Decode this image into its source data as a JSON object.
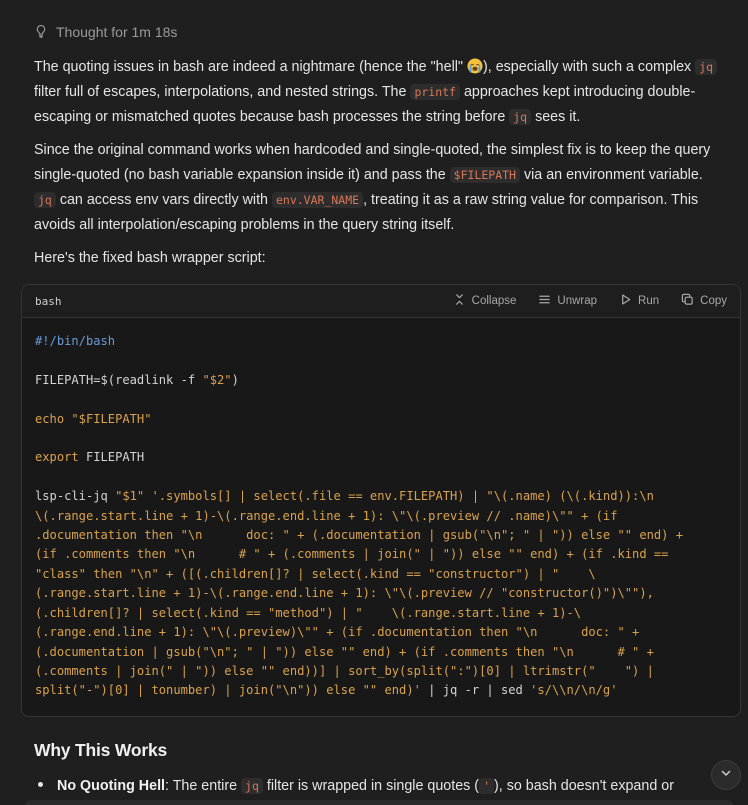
{
  "thought": {
    "label": "Thought for 1m 18s",
    "icon": "lightbulb-icon"
  },
  "paragraphs": {
    "p1": {
      "t1": "The quoting issues in bash are indeed a nightmare (hence the \"hell\" ",
      "t2": "), especially with such a complex",
      "c1": "jq",
      "t3": " filter full of escapes, interpolations, and nested strings. The ",
      "c2": "printf",
      "t4": " approaches kept introducing double-escaping or mismatched quotes because bash processes the string before ",
      "c3": "jq",
      "t5": " sees it."
    },
    "p2": {
      "t1": "Since the original command works when hardcoded and single-quoted, the simplest fix is to keep the query single-quoted (no bash variable expansion inside it) and pass the ",
      "c1": "$FILEPATH",
      "t2": " via an environment variable. ",
      "c2": "jq",
      "t3": " can access env vars directly with ",
      "c3": "env.VAR_NAME",
      "t4": ", treating it as a raw string value for comparison. This avoids all interpolation/escaping problems in the query string itself."
    },
    "p3": "Here's the fixed bash wrapper script:"
  },
  "codeblock": {
    "language": "bash",
    "actions": {
      "collapse": "Collapse",
      "unwrap": "Unwrap",
      "run": "Run",
      "copy": "Copy"
    },
    "lines": {
      "shebang": "#!/bin/bash",
      "l2a": "FILEPATH=$(readlink -f ",
      "l2b": "\"$2\"",
      "l2c": ")",
      "l3a": "echo",
      "l3b": " ",
      "l3c": "\"$FILEPATH\"",
      "l4a": "export",
      "l4b": " FILEPATH",
      "l5a": "lsp-cli-jq ",
      "l5b": "\"$1\"",
      "l5c": " '.symbols[] | select(.file == env.FILEPATH) | \"\\(.name) (\\(.kind)):\\n\n\\(.range.start.line + 1)-\\(.range.end.line + 1): \\\"\\(.preview // .name)\\\"\" + (if\n.documentation then \"\\n      doc: \" + (.documentation | gsub(\"\\n\"; \" | \")) else \"\" end) +\n(if .comments then \"\\n      # \" + (.comments | join(\" | \")) else \"\" end) + (if .kind ==\n\"class\" then \"\\n\" + ([(.children[]? | select(.kind == \"constructor\") | \"    \\\n(.range.start.line + 1)-\\(.range.end.line + 1): \\\"\\(.preview // \"constructor()\")\\\"\"),\n(.children[]? | select(.kind == \"method\") | \"    \\(.range.start.line + 1)-\\\n(.range.end.line + 1): \\\"\\(.preview)\\\"\" + (if .documentation then \"\\n      doc: \" +\n(.documentation | gsub(\"\\n\"; \" | \")) else \"\" end) + (if .comments then \"\\n      # \" +\n(.comments | join(\" | \")) else \"\" end))] | sort_by(split(\":\")[0] | ltrimstr(\"    \") |\nsplit(\"-\")[0] | tonumber) | join(\"\\n\")) else \"\" end)'",
      "l5d": " | jq -r | sed ",
      "l5e": "'s/\\\\n/\\n/g'"
    }
  },
  "heading": "Why This Works",
  "bullet": {
    "bold": "No Quoting Hell",
    "t1": ": The entire ",
    "c1": "jq",
    "t2": " filter is wrapped in single quotes (",
    "c2": "'",
    "t3": "), so bash doesn't expand or"
  }
}
